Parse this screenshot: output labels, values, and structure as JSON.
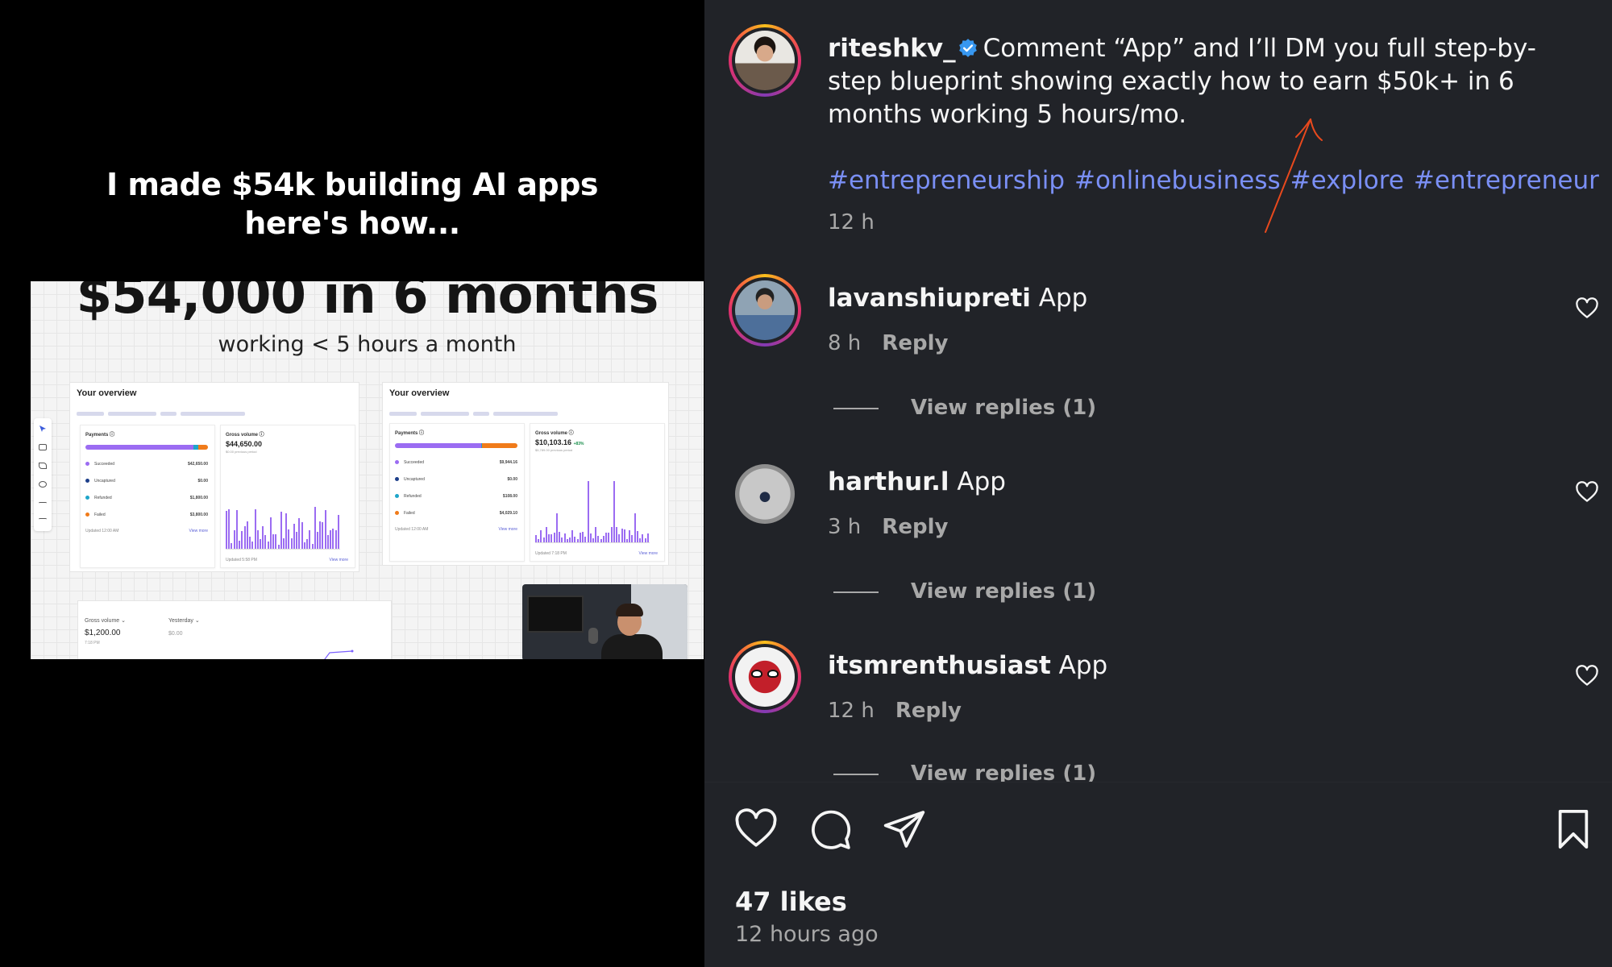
{
  "media": {
    "caption_line1": "I made $54k building AI apps",
    "caption_line2": "here's how...",
    "slide_headline": "$54,000 in 6 months",
    "slide_subtitle": "working < 5 hours a month",
    "overview_left": {
      "title": "Your overview",
      "payments_label": "Payments ⓘ",
      "rows": [
        {
          "label": "Succeeded",
          "amount": "$42,650.00",
          "color": "#9b6cf2"
        },
        {
          "label": "Uncaptured",
          "amount": "$0.00",
          "color": "#1d3f8a"
        },
        {
          "label": "Refunded",
          "amount": "$1,800.00",
          "color": "#1ea5c9"
        },
        {
          "label": "Failed",
          "amount": "$3,800.00",
          "color": "#f07b1a"
        }
      ],
      "updated": "Updated 12:00 AM",
      "view_more": "View more",
      "gross_label": "Gross volume ⓘ",
      "gross_value": "$44,650.00",
      "gross_prev": "$0.00 previous period",
      "gross_updated": "Updated 5:58 PM"
    },
    "overview_right": {
      "title": "Your overview",
      "payments_label": "Payments ⓘ",
      "rows": [
        {
          "label": "Succeeded",
          "amount": "$9,944.16",
          "color": "#9b6cf2"
        },
        {
          "label": "Uncaptured",
          "amount": "$0.00",
          "color": "#1d3f8a"
        },
        {
          "label": "Refunded",
          "amount": "$108.00",
          "color": "#1ea5c9"
        },
        {
          "label": "Failed",
          "amount": "$4,029.10",
          "color": "#f07b1a"
        }
      ],
      "updated": "Updated 12:00 AM",
      "view_more": "View more",
      "gross_label": "Gross volume ⓘ",
      "gross_value": "$10,103.16",
      "gross_change": "+83%",
      "gross_prev": "$5,789.00 previous period",
      "gross_updated": "Updated 7:18 PM"
    },
    "bottom_card": {
      "gross_label": "Gross volume ⌄",
      "gross_value": "$1,200.00",
      "gross_time": "7:18 PM",
      "yesterday_label": "Yesterday ⌄",
      "yesterday_value": "$0.00"
    }
  },
  "post": {
    "username": "riteshkv_",
    "caption": "Comment “App” and I’ll DM you full step-by-step blueprint showing exactly how to earn $50k+ in 6 months working 5 hours/mo.",
    "hashtags": [
      "#entrepreneurship",
      "#onlinebusiness",
      "#explore",
      "#entrepreneur"
    ],
    "time": "12 h"
  },
  "comments": [
    {
      "username": "lavanshiupreti",
      "text": "App",
      "time": "8 h",
      "reply": "Reply",
      "view_replies": "View replies (1)"
    },
    {
      "username": "harthur.l",
      "text": "App",
      "time": "3 h",
      "reply": "Reply",
      "view_replies": "View replies (1)"
    },
    {
      "username": "itsmrenthusiast",
      "text": "App",
      "time": "12 h",
      "reply": "Reply",
      "view_replies": "View replies (1)"
    }
  ],
  "actions": {
    "like_icon": "heart-icon",
    "comment_icon": "comment-icon",
    "share_icon": "paper-plane-icon",
    "save_icon": "bookmark-icon",
    "likes": "47 likes",
    "time_ago": "12 hours ago"
  },
  "colors": {
    "panel_bg": "#212328",
    "hashtag": "#7a8ff5",
    "annotation_arrow": "#e8491d",
    "verified": "#3797f0",
    "muted_text": "#a8a8a8"
  }
}
